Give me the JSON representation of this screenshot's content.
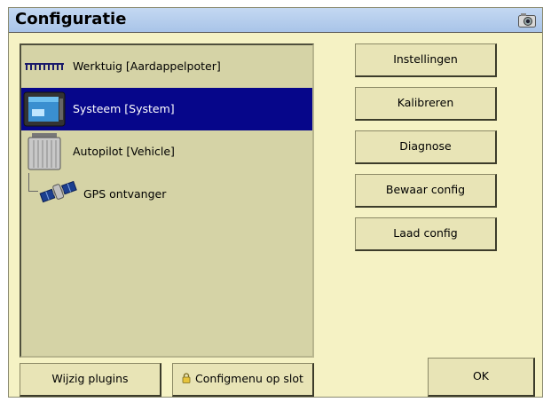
{
  "window": {
    "title": "Configuratie",
    "title_icon": "camera-icon"
  },
  "tree": {
    "items": [
      {
        "label": "Werktuig [Aardappelpoter]",
        "icon": "implement-icon",
        "selected": false
      },
      {
        "label": "Systeem [System]",
        "icon": "display-terminal-icon",
        "selected": true
      },
      {
        "label": "Autopilot [Vehicle]",
        "icon": "autopilot-controller-icon",
        "selected": false
      },
      {
        "label": "GPS ontvanger",
        "icon": "gps-satellite-icon",
        "selected": false
      }
    ]
  },
  "actions": {
    "instellingen": "Instellingen",
    "kalibreren": "Kalibreren",
    "diagnose": "Diagnose",
    "bewaar": "Bewaar config",
    "laad": "Laad config"
  },
  "bottom": {
    "wijzig": "Wijzig plugins",
    "lock": "Configmenu op slot",
    "ok": "OK"
  },
  "colors": {
    "background": "#f5f2c4",
    "selection": "#06068a",
    "titlebar": "#b6cdee"
  }
}
